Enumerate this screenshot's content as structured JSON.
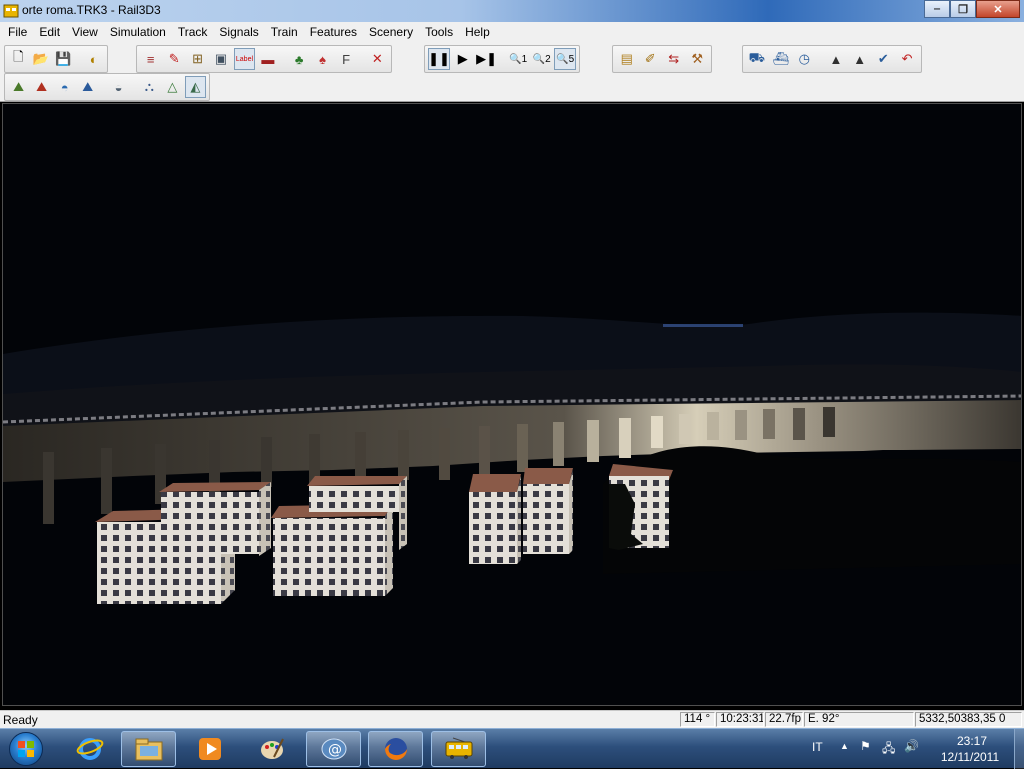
{
  "window": {
    "title": "orte roma.TRK3 - Rail3D3",
    "minimize": "‒",
    "maximize": "❐",
    "close": "✕"
  },
  "menu": [
    "File",
    "Edit",
    "View",
    "Simulation",
    "Track",
    "Signals",
    "Train",
    "Features",
    "Scenery",
    "Tools",
    "Help"
  ],
  "toolbar": {
    "label_icon_text": "Label"
  },
  "status": {
    "ready": "Ready",
    "angle": "114 °",
    "clock": "10:23:31",
    "fps": "22.7fp",
    "heading": "E. 92°",
    "coords": "5332,50383,35 0"
  },
  "taskbar": {
    "language": "IT",
    "time": "23:17",
    "date": "12/11/2011",
    "apps": [
      "internet-explorer",
      "windows-explorer",
      "media-player",
      "paint",
      "email",
      "firefox",
      "rail3d"
    ]
  },
  "colors": {
    "sky": "#020408",
    "viaduct": "#b5ad9a",
    "building_wall": "#e6e3dc",
    "roof": "#8a5a48"
  }
}
